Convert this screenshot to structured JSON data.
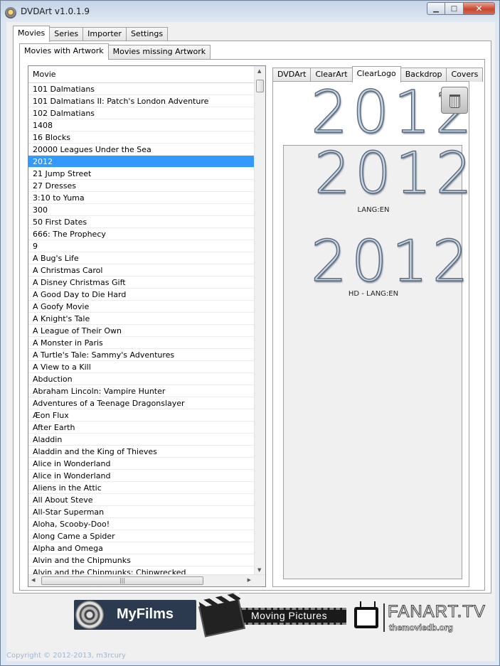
{
  "window": {
    "title": "DVDArt v1.0.1.9",
    "buttons": {
      "minimize": "▁",
      "maximize": "□",
      "close": "✕"
    }
  },
  "main_tabs": [
    "Movies",
    "Series",
    "Importer",
    "Settings"
  ],
  "sub_tabs": [
    "Movies with Artwork",
    "Movies missing Artwork"
  ],
  "art_tabs": [
    "DVDArt",
    "ClearArt",
    "ClearLogo",
    "Backdrop",
    "Covers"
  ],
  "list": {
    "header": "Movie",
    "selected_index": 6,
    "items": [
      "101 Dalmatians",
      "101 Dalmatians II: Patch's London Adventure",
      "102 Dalmatians",
      "1408",
      "16 Blocks",
      "20000 Leagues Under the Sea",
      "2012",
      "21 Jump Street",
      "27 Dresses",
      "3:10 to Yuma",
      "300",
      "50 First Dates",
      "666: The Prophecy",
      "9",
      "A Bug's Life",
      "A Christmas Carol",
      "A Disney Christmas Gift",
      "A Good Day to Die Hard",
      "A Goofy Movie",
      "A Knight's Tale",
      "A League of Their Own",
      "A Monster in Paris",
      "A Turtle's Tale: Sammy's Adventures",
      "A View to a Kill",
      "Abduction",
      "Abraham Lincoln: Vampire Hunter",
      "Adventures of a Teenage Dragonslayer",
      "Æon Flux",
      "After Earth",
      "Aladdin",
      "Aladdin and the King of Thieves",
      "Alice in Wonderland",
      "Alice in Wonderland",
      "Aliens in the Attic",
      "All About Steve",
      "All-Star Superman",
      "Aloha, Scooby-Doo!",
      "Along Came a Spider",
      "Alpha and Omega",
      "Alvin and the Chipmunks",
      "Alvin and the Chipmunks: Chipwrecked"
    ]
  },
  "artwork": {
    "current_logo": "2012",
    "options": [
      {
        "logo": "2012",
        "caption": "LANG:EN"
      },
      {
        "logo": "2012",
        "caption": "HD - LANG:EN"
      }
    ]
  },
  "footer": {
    "myfilms": "MyFilms",
    "moving_pictures": "Moving Pictures",
    "fanart": "FANART.TV",
    "tmdb": "themoviedb.org",
    "copyright": "Copyright © 2012-2013, m3rcury"
  },
  "icons": [
    "app-icon",
    "trash-icon",
    "film-reel-icon",
    "clapperboard-icon",
    "tv-icon"
  ]
}
